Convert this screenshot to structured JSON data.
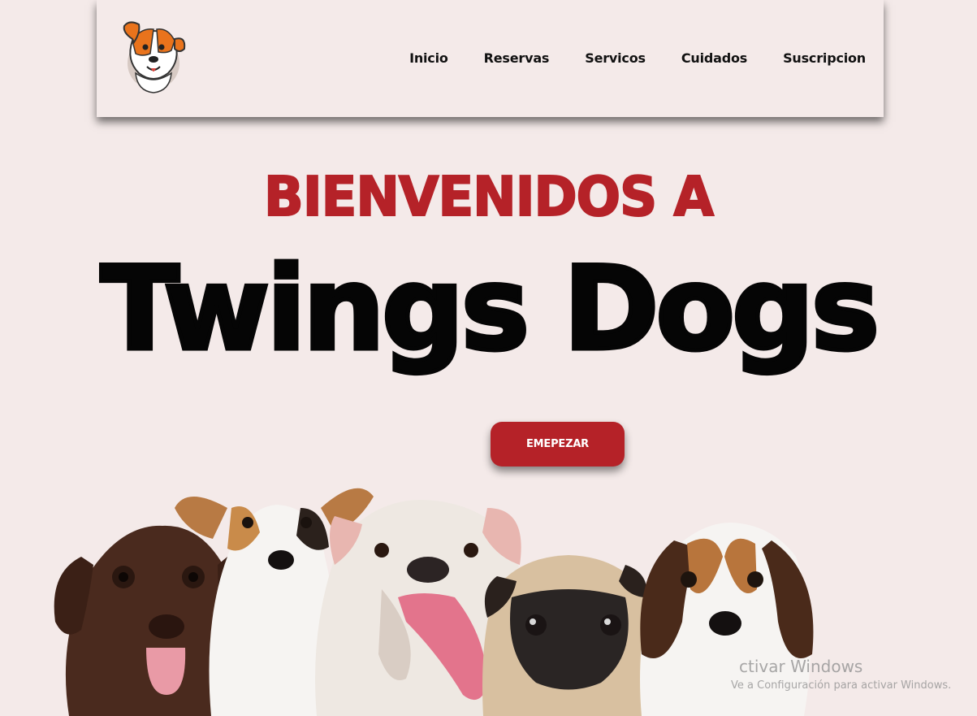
{
  "nav": {
    "logo_icon": "dog-logo-icon",
    "links": [
      "Inicio",
      "Reservas",
      "Servicos",
      "Cuidados",
      "Suscripcion"
    ]
  },
  "hero": {
    "subtitle": "BIENVENIDOS A",
    "title": "Twings Dogs",
    "cta_label": "EMEPEZAR"
  },
  "image": {
    "name": "dogs-group-photo"
  },
  "watermark": {
    "title": "ctivar Windows",
    "subtitle": "Ve a Configuración para activar Windows."
  },
  "colors": {
    "background": "#f4eae9",
    "accent": "#b52228",
    "text": "#050505"
  }
}
